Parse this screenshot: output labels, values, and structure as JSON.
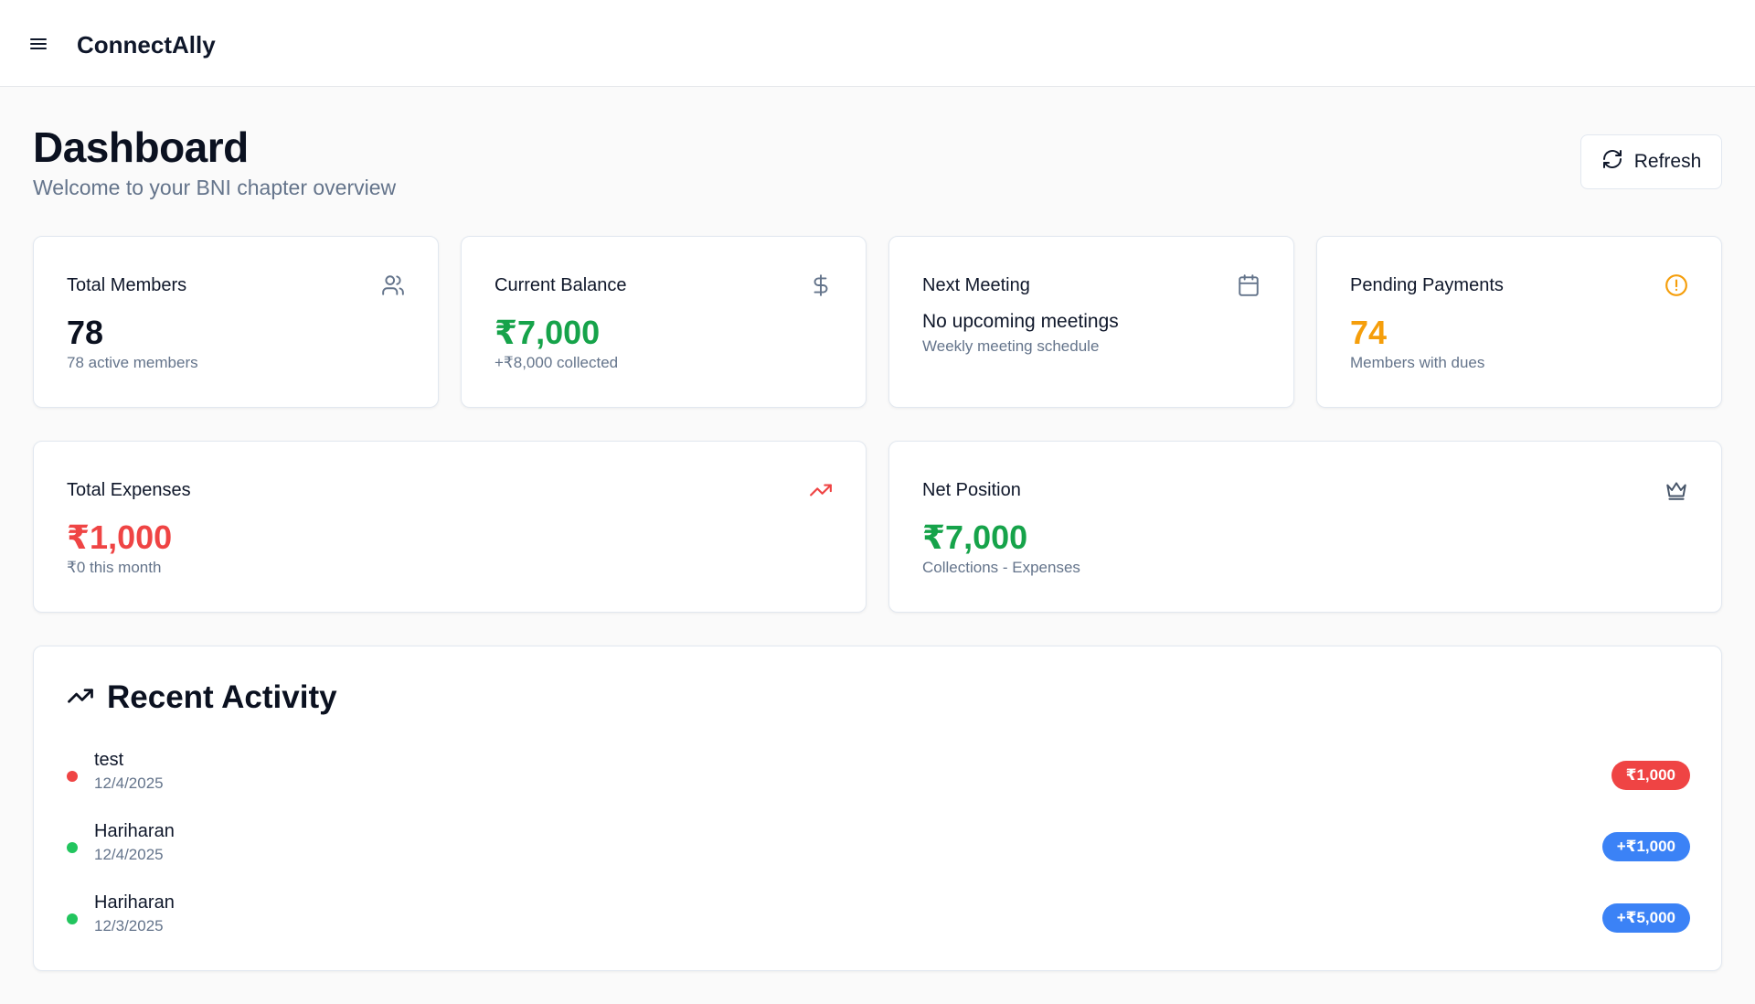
{
  "app": {
    "title": "ConnectAlly"
  },
  "header": {
    "title": "Dashboard",
    "subtitle": "Welcome to your BNI chapter overview",
    "refresh_label": "Refresh"
  },
  "stats": [
    {
      "label": "Total Members",
      "value": "78",
      "sub": "78 active members",
      "icon": "users-icon"
    },
    {
      "label": "Current Balance",
      "value": "₹7,000",
      "sub": "+₹8,000 collected",
      "icon": "dollar-icon"
    },
    {
      "label": "Next Meeting",
      "value": "No upcoming meetings",
      "sub": "Weekly meeting schedule",
      "icon": "calendar-icon"
    },
    {
      "label": "Pending Payments",
      "value": "74",
      "sub": "Members with dues",
      "icon": "alert-circle-icon"
    },
    {
      "label": "Total Expenses",
      "value": "₹1,000",
      "sub": "₹0 this month",
      "icon": "trending-up-icon"
    },
    {
      "label": "Net Position",
      "value": "₹7,000",
      "sub": "Collections - Expenses",
      "icon": "crown-icon"
    }
  ],
  "activity": {
    "title": "Recent Activity",
    "items": [
      {
        "name": "test",
        "date": "12/4/2025",
        "amount": "₹1,000",
        "dot_color": "#ef4444",
        "badge_color": "#ef4444"
      },
      {
        "name": "Hariharan",
        "date": "12/4/2025",
        "amount": "+₹1,000",
        "dot_color": "#22c55e",
        "badge_color": "#3b82f6"
      },
      {
        "name": "Hariharan",
        "date": "12/3/2025",
        "amount": "+₹5,000",
        "dot_color": "#22c55e",
        "badge_color": "#3b82f6"
      }
    ]
  },
  "colors": {
    "green": "#16a34a",
    "orange": "#f59e0b",
    "red": "#ef4444",
    "blue": "#3b82f6",
    "muted": "#64748b"
  }
}
